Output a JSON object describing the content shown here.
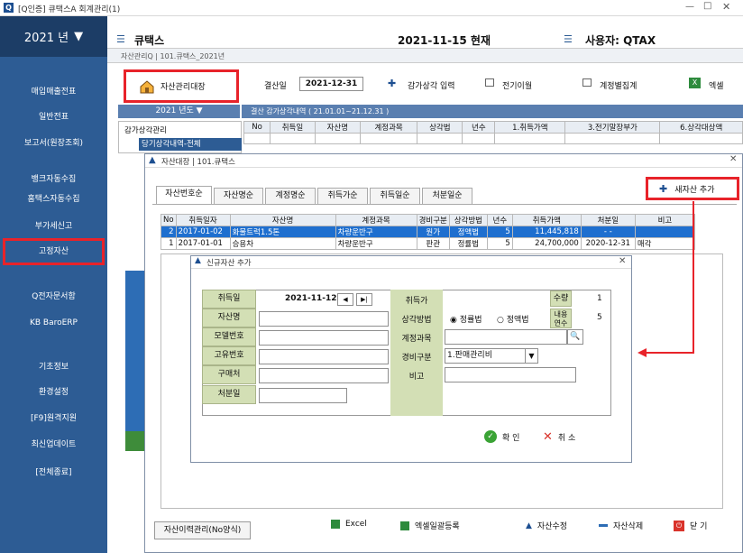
{
  "window": {
    "title": "[Q인증] 큐택스A  회계관리(1)"
  },
  "topbar": {
    "company": "큐택스",
    "date_now": "2021-11-15 현재",
    "user": "사용자: QTAX"
  },
  "sidebar": {
    "year": "2021 년",
    "items": [
      "매입매출전표",
      "일반전표",
      "보고서(원장조회)",
      "뱅크자동수집",
      "홈택스자동수집",
      "부가세신고",
      "고정자산",
      "Q전자문서함",
      "KB BaroERP",
      "기초정보",
      "환경설정",
      "[F9]원격지원",
      "최신업데이트",
      "[전체종료]"
    ]
  },
  "background": {
    "tab_title": "자산관리Q | 101.큐택스_2021년",
    "btn_asset_ledger": "자산관리대장",
    "closing_label": "결산일",
    "closing_date": "2021-12-31",
    "btn_depreciation": "감가상각 입력",
    "btn_transfer": "전기이월",
    "btn_account_sum": "계정별집계",
    "btn_excel": "엑셀",
    "year_bar": "2021 년도",
    "period_title": "결산 감가상각내역 ( 21.01.01~21.12.31 )",
    "tree_root": "감가상각관리",
    "tree_item": "당기상각내역-전체",
    "bg_headers": [
      "No",
      "취득일",
      "자산명",
      "계정과목",
      "상각법",
      "년수",
      "1.취득가액",
      "3.전기말장부가",
      "6.상각대상액"
    ]
  },
  "dialog_asset": {
    "title": "자산대장 | 101.큐택스",
    "add_button": "새자산 추가",
    "tabs": [
      "자산번호순",
      "자산명순",
      "계정명순",
      "취득가순",
      "취득일순",
      "처분일순"
    ],
    "headers": [
      "No",
      "취득일자",
      "자산명",
      "계정과목",
      "경비구분",
      "상각방법",
      "년수",
      "취득가액",
      "처분일",
      "비고"
    ],
    "rows": [
      [
        "2",
        "2017-01-02",
        "화물트럭1.5톤",
        "차량운반구",
        "원가",
        "정액법",
        "5",
        "11,445,818",
        "-  -",
        ""
      ],
      [
        "1",
        "2017-01-01",
        "승용차",
        "차량운반구",
        "판관",
        "정률법",
        "5",
        "24,700,000",
        "2020-12-31",
        "매각"
      ]
    ],
    "bottom": {
      "history": "자산이력관리(No양식)",
      "excel": "Excel",
      "excel_upload": "엑셀일괄등록",
      "modify": "자산수정",
      "delete": "자산삭제",
      "close": "닫 기"
    }
  },
  "dialog_new": {
    "title": "신규자산 추가",
    "labels": {
      "acq_date": "취득일",
      "asset_name": "자산명",
      "model": "모델번호",
      "unique": "고유번호",
      "vendor": "구매처",
      "disposal": "처분일",
      "acq_price": "취득가",
      "method": "상각방법",
      "account": "계정과목",
      "expense": "경비구분",
      "memo": "비고",
      "qty": "수량",
      "years": "내용연수"
    },
    "values": {
      "acq_date": "2021-11-12",
      "qty": "1",
      "years": "5",
      "method_a": "정률법",
      "method_b": "정액법",
      "expense": "1.판매관리비"
    },
    "ok": "확 인",
    "cancel": "취 소"
  }
}
